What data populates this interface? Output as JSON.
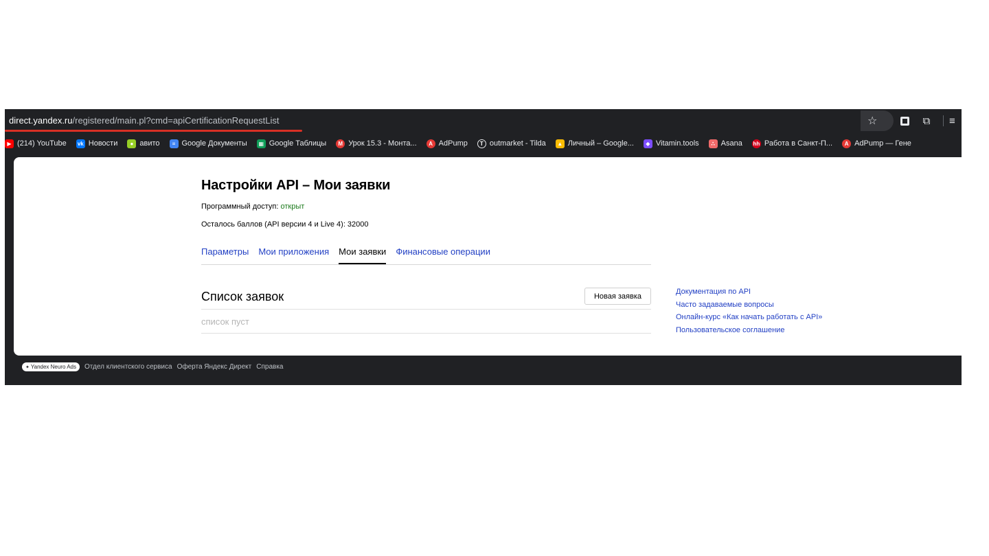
{
  "address_bar": {
    "url_host": "direct.yandex.ru",
    "url_path": "/registered/main.pl?cmd=apiCertificationRequestList"
  },
  "toolbar": {
    "icons": [
      "star-icon",
      "extension-icon",
      "puzzle-icon",
      "media-control-icon"
    ]
  },
  "bookmarks": [
    {
      "label": "(214) YouTube",
      "icon": "youtube-icon",
      "color": "#ff0000",
      "glyph": "▶"
    },
    {
      "label": "Новости",
      "icon": "vk-icon",
      "color": "#0077ff",
      "glyph": "vk"
    },
    {
      "label": "авито",
      "icon": "avito-icon",
      "color": "#97cf26",
      "glyph": "●"
    },
    {
      "label": "Google Документы",
      "icon": "google-docs-icon",
      "color": "#4285f4",
      "glyph": "≡"
    },
    {
      "label": "Google Таблицы",
      "icon": "google-sheets-icon",
      "color": "#0f9d58",
      "glyph": "▦"
    },
    {
      "label": "Урок 15.3 - Монта...",
      "icon": "lesson-icon",
      "color": "#e53935",
      "glyph": "M"
    },
    {
      "label": "AdPump",
      "icon": "adpump-icon",
      "color": "#e53935",
      "glyph": "A"
    },
    {
      "label": "outmarket - Tilda",
      "icon": "tilda-icon",
      "color": "#202124",
      "glyph": "T"
    },
    {
      "label": "Личный – Google...",
      "icon": "google-drive-icon",
      "color": "#fbbc04",
      "glyph": "▲"
    },
    {
      "label": "Vitamin.tools",
      "icon": "vitamin-icon",
      "color": "#7c4dff",
      "glyph": "◆"
    },
    {
      "label": "Asana",
      "icon": "asana-icon",
      "color": "#f06a6a",
      "glyph": "∴"
    },
    {
      "label": "Работа в Санкт-П...",
      "icon": "hh-icon",
      "color": "#d6001c",
      "glyph": "hh"
    },
    {
      "label": "AdPump — Гене",
      "icon": "adpump-icon",
      "color": "#e53935",
      "glyph": "A"
    }
  ],
  "page": {
    "title": "Настройки API – Мои заявки",
    "access_label": "Программный доступ: ",
    "access_status": "открыт",
    "points_line": "Осталось баллов (API версии 4 и Live 4): 32000",
    "tabs": [
      {
        "label": "Параметры",
        "active": false
      },
      {
        "label": "Мои приложения",
        "active": false
      },
      {
        "label": "Мои заявки",
        "active": true
      },
      {
        "label": "Финансовые операции",
        "active": false
      }
    ],
    "list_title": "Список заявок",
    "new_request_button": "Новая заявка",
    "empty_text": "список пуст",
    "side_links": [
      "Документация по API",
      "Часто задаваемые вопросы",
      "Онлайн-курс «Как начать работать с API»",
      "Пользовательское соглашение"
    ]
  },
  "footer": {
    "badge": "Yandex Neuro Ads",
    "links": [
      "Отдел клиентского сервиса",
      "Оферта Яндекс Директ",
      "Справка"
    ]
  },
  "colors": {
    "chrome_dark": "#202124",
    "link_blue": "#2240c4",
    "status_green": "#1b7a1b",
    "loading_red": "#d93025"
  }
}
